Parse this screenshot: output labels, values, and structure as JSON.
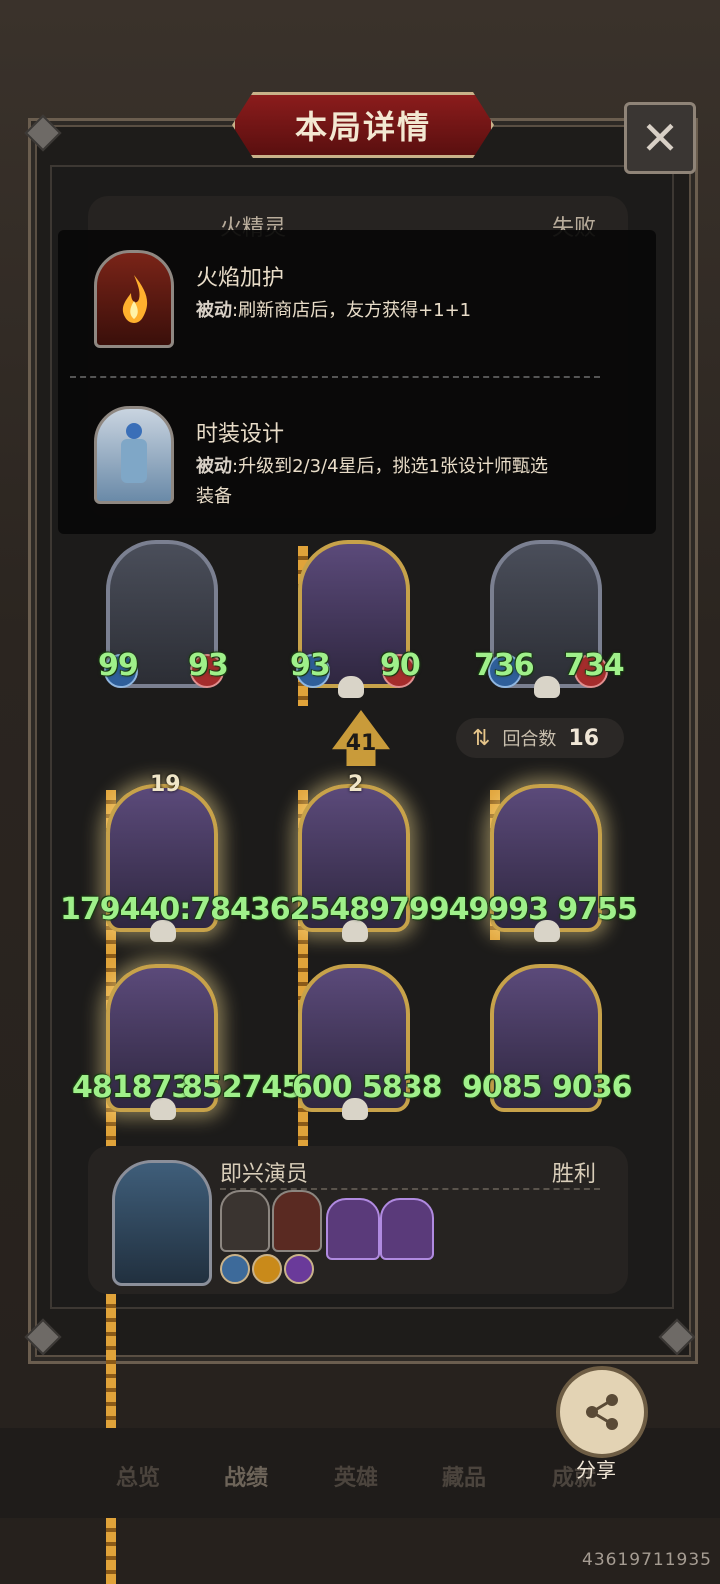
{
  "header": {
    "title": "本局详情",
    "close_glyph": "✕"
  },
  "top_card": {
    "name": "火精灵",
    "result": "失败"
  },
  "tooltip": {
    "skills": [
      {
        "icon": "flame-icon",
        "title": "火焰加护",
        "tag": "被动",
        "desc": ":刷新商店后，友方获得+1+1"
      },
      {
        "icon": "fashion-design-icon",
        "title": "时装设计",
        "tag": "被动",
        "desc": ":升级到2/3/4星后，挑选1张设计师甄选",
        "desc2": "装备"
      }
    ]
  },
  "units_row1": [
    {
      "name": "robot-camera-unit",
      "attack": "99",
      "health": "93"
    },
    {
      "name": "dark-robot-unit",
      "attack": "93",
      "health": "90"
    },
    {
      "name": "wolf-monster-unit",
      "attack": "736",
      "health": "734"
    }
  ],
  "arrow_badge": "41",
  "rounds": {
    "label": "回合数",
    "value": "16"
  },
  "units_row2": [
    {
      "name": "musketeer-unit",
      "level": "19",
      "attack": "179440",
      "health": "784"
    },
    {
      "name": "blue-hair-mage-unit",
      "level": "2",
      "attack": "362548",
      "health": "979"
    },
    {
      "name": "moon-witch-unit",
      "level": "",
      "attack": "94999",
      "health": "39755"
    }
  ],
  "stats_row2_text": "179440:784362548979949993 9755",
  "units_row3": [
    {
      "name": "king-unit",
      "attack": "481873",
      "health": "852745"
    },
    {
      "name": "tv-robot-unit",
      "attack": "600",
      "health": "5838"
    },
    {
      "name": "pirate-girl-unit",
      "attack": "9085",
      "health": "9036"
    }
  ],
  "bottom_card": {
    "name": "即兴演员",
    "result": "胜利"
  },
  "nav": {
    "items": [
      "总览",
      "战绩",
      "英雄",
      "藏品",
      "成就"
    ],
    "active": "战绩"
  },
  "share": {
    "label": "分享"
  },
  "uid": "43619711935",
  "colors": {
    "stat_green": "#9ff08a",
    "banner_red": "#8b1c1c",
    "gold": "#c7a24a"
  }
}
